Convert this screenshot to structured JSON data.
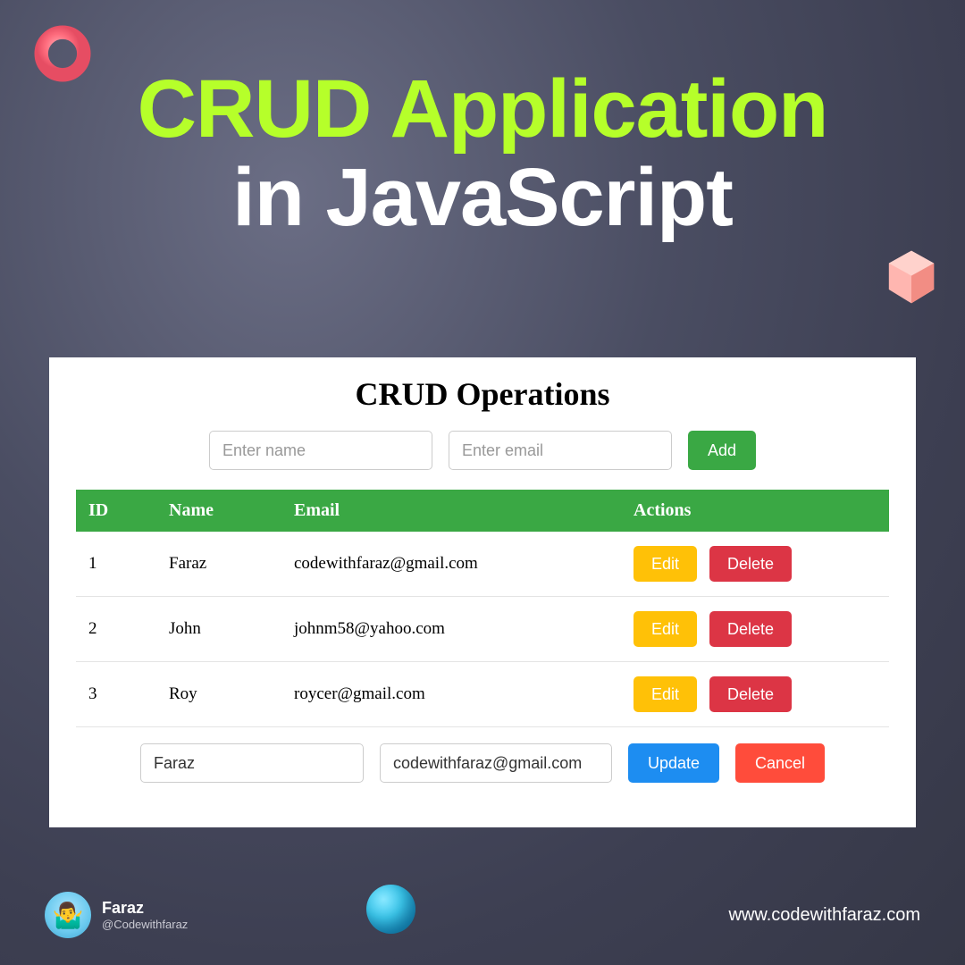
{
  "title": {
    "line1": "CRUD Application",
    "line2": "in JavaScript"
  },
  "crud": {
    "heading": "CRUD Operations",
    "name_placeholder": "Enter name",
    "email_placeholder": "Enter email",
    "add_label": "Add",
    "headers": {
      "id": "ID",
      "name": "Name",
      "email": "Email",
      "actions": "Actions"
    },
    "rows": [
      {
        "id": "1",
        "name": "Faraz",
        "email": "codewithfaraz@gmail.com"
      },
      {
        "id": "2",
        "name": "John",
        "email": "johnm58@yahoo.com"
      },
      {
        "id": "3",
        "name": "Roy",
        "email": "roycer@gmail.com"
      }
    ],
    "edit_label": "Edit",
    "delete_label": "Delete",
    "update_label": "Update",
    "cancel_label": "Cancel",
    "edit_values": {
      "name": "Faraz",
      "email": "codewithfaraz@gmail.com"
    }
  },
  "author": {
    "name": "Faraz",
    "handle": "@Codewithfaraz",
    "avatar_emoji": "🤷‍♂️"
  },
  "site": "www.codewithfaraz.com"
}
